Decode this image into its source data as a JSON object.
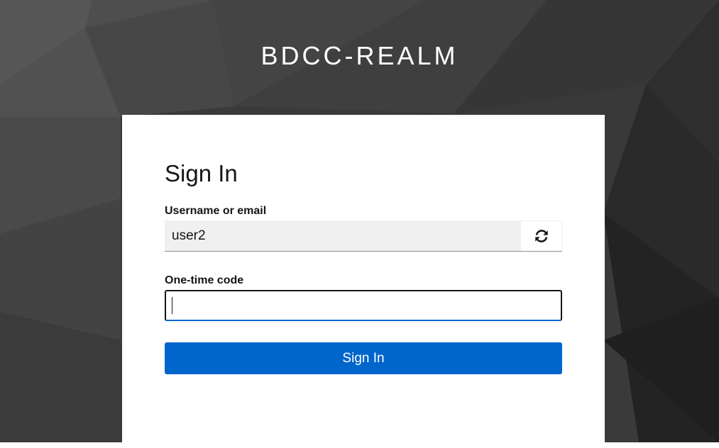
{
  "realm": {
    "title": "BDCC-REALM"
  },
  "login": {
    "heading": "Sign In",
    "username_label": "Username or email",
    "username_value": "user2",
    "restart_icon": "refresh-icon",
    "otp_label": "One-time code",
    "otp_value": "",
    "submit_label": "Sign In"
  },
  "colors": {
    "background": "#3a3a3a",
    "primary": "#0066cc",
    "card": "#ffffff",
    "readonly_field": "#f0f0f0"
  }
}
